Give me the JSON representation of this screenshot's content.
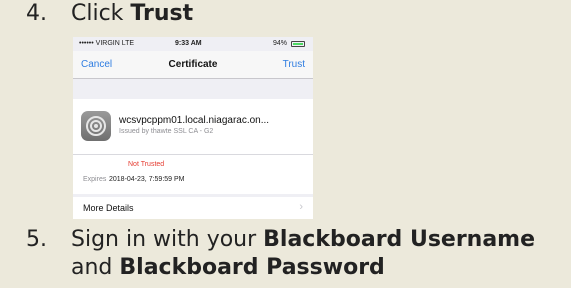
{
  "steps": [
    {
      "number": "4.",
      "prefix": "Click ",
      "bold": "Trust"
    },
    {
      "number": "5.",
      "prefix": "Sign in with your ",
      "bold1": "Blackboard Username",
      "mid": "and ",
      "bold2": "Blackboard Password"
    }
  ],
  "phone": {
    "status": {
      "carrier": "•••••• VIRGIN  LTE",
      "time": "9:33 AM",
      "battery": "94%"
    },
    "nav": {
      "cancel": "Cancel",
      "title": "Certificate",
      "trust": "Trust"
    },
    "cert": {
      "host": "wcsvpcppm01.local.niagarac.on...",
      "issued_by": "Issued by thawte SSL CA - G2",
      "status": "Not Trusted",
      "expires_label": "Expires",
      "expires_value": "2018-04-23, 7:59:59 PM"
    },
    "more_details": "More Details",
    "icons": {
      "cert": "settings-gear-icon",
      "chevron": "chevron-right-icon",
      "battery": "battery-icon"
    },
    "colors": {
      "link": "#2f7de1",
      "warning": "#e53b30",
      "background": "#ece9db"
    }
  }
}
